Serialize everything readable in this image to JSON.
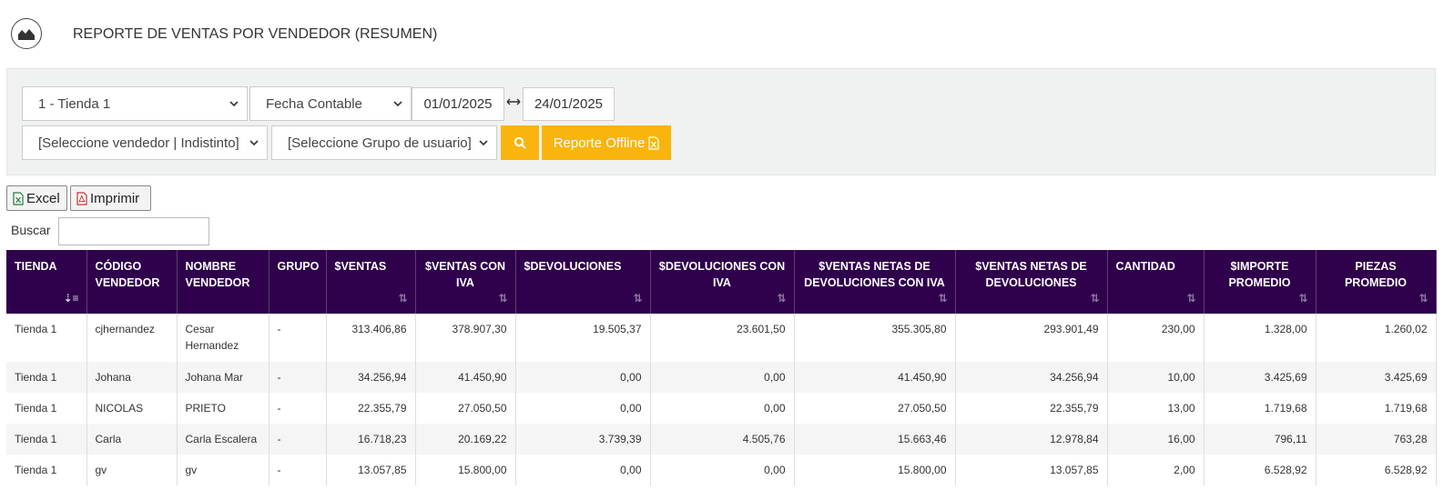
{
  "header": {
    "title": "REPORTE DE VENTAS POR VENDEDOR (RESUMEN)",
    "logo_icon": "area-chart-icon"
  },
  "filters": {
    "store": "1 - Tienda 1",
    "date_type": "Fecha Contable",
    "date_from": "01/01/2025",
    "date_to": "24/01/2025",
    "seller": "[Seleccione vendedor | Indistinto]",
    "user_group": "[Seleccione Grupo de usuario]",
    "search_icon": "search-icon",
    "offline_label": "Reporte Offline"
  },
  "toolbar": {
    "excel_label": "Excel",
    "print_label": "Imprimir"
  },
  "search": {
    "label": "Buscar",
    "value": ""
  },
  "table": {
    "columns": [
      "TIENDA",
      "CÓDIGO VENDEDOR",
      "NOMBRE VENDEDOR",
      "GRUPO",
      "$VENTAS",
      "$VENTAS CON IVA",
      "$DEVOLUCIONES",
      "$DEVOLUCIONES CON IVA",
      "$VENTAS NETAS DE DEVOLUCIONES CON IVA",
      "$VENTAS NETAS DE DEVOLUCIONES",
      "CANTIDAD",
      "$IMPORTE PROMEDIO",
      "PIEZAS PROMEDIO"
    ],
    "rows": [
      [
        "Tienda 1",
        "cjhernandez",
        "Cesar Hernandez",
        "-",
        "313.406,86",
        "378.907,30",
        "19.505,37",
        "23.601,50",
        "355.305,80",
        "293.901,49",
        "230,00",
        "1.328,00",
        "1.260,02"
      ],
      [
        "Tienda 1",
        "Johana",
        "Johana Mar",
        "-",
        "34.256,94",
        "41.450,90",
        "0,00",
        "0,00",
        "41.450,90",
        "34.256,94",
        "10,00",
        "3.425,69",
        "3.425,69"
      ],
      [
        "Tienda 1",
        "NICOLAS",
        "PRIETO",
        "-",
        "22.355,79",
        "27.050,50",
        "0,00",
        "0,00",
        "27.050,50",
        "22.355,79",
        "13,00",
        "1.719,68",
        "1.719,68"
      ],
      [
        "Tienda 1",
        "Carla",
        "Carla Escalera",
        "-",
        "16.718,23",
        "20.169,22",
        "3.739,39",
        "4.505,76",
        "15.663,46",
        "12.978,84",
        "16,00",
        "796,11",
        "763,28"
      ],
      [
        "Tienda 1",
        "gv",
        "gv",
        "-",
        "13.057,85",
        "15.800,00",
        "0,00",
        "0,00",
        "15.800,00",
        "13.057,85",
        "2,00",
        "6.528,92",
        "6.528,92"
      ]
    ]
  },
  "colors": {
    "header_bg": "#2f004c",
    "accent": "#f9b50d",
    "panel_bg": "#f0f1f1"
  }
}
